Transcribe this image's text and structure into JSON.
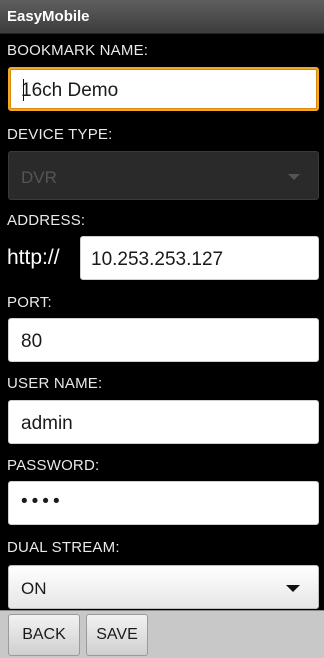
{
  "app": {
    "title": "EasyMobile"
  },
  "form": {
    "bookmark_label": "BOOKMARK NAME:",
    "bookmark_value": "16ch Demo",
    "device_type_label": "DEVICE TYPE:",
    "device_type_value": "DVR",
    "address_label": "ADDRESS:",
    "address_prefix": "http://",
    "address_value": "10.253.253.127",
    "port_label": "PORT:",
    "port_value": "80",
    "username_label": "USER NAME:",
    "username_value": "admin",
    "password_label": "PASSWORD:",
    "password_masked": "••••",
    "dual_stream_label": "DUAL STREAM:",
    "dual_stream_value": "ON"
  },
  "actions": {
    "back_label": "BACK",
    "save_label": "SAVE"
  }
}
